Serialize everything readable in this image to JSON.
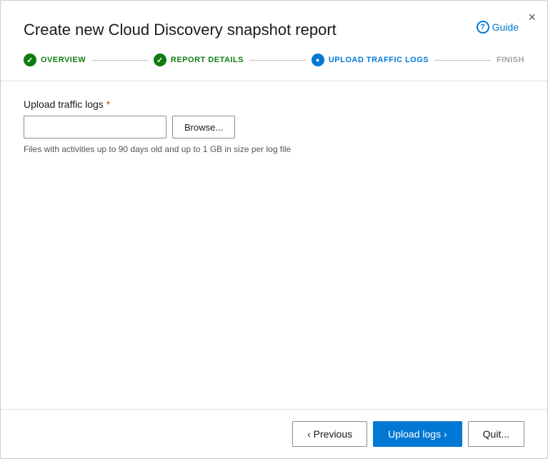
{
  "dialog": {
    "title": "Create new Cloud Discovery snapshot report",
    "close_label": "×"
  },
  "guide": {
    "label": "Guide",
    "icon": "?"
  },
  "stepper": {
    "steps": [
      {
        "id": "overview",
        "label": "OVERVIEW",
        "state": "complete"
      },
      {
        "id": "report-details",
        "label": "REPORT DETAILS",
        "state": "complete"
      },
      {
        "id": "upload-traffic-logs",
        "label": "UPLOAD TRAFFIC LOGS",
        "state": "active"
      },
      {
        "id": "finish",
        "label": "FINISH",
        "state": "inactive"
      }
    ]
  },
  "content": {
    "field_label": "Upload traffic logs",
    "required_marker": " *",
    "file_input_placeholder": "",
    "browse_button_label": "Browse...",
    "hint_text": "Files with activities up to 90 days old and up to 1 GB in size per log file"
  },
  "footer": {
    "previous_label": "‹ Previous",
    "upload_label": "Upload logs ›",
    "quit_label": "Quit..."
  }
}
